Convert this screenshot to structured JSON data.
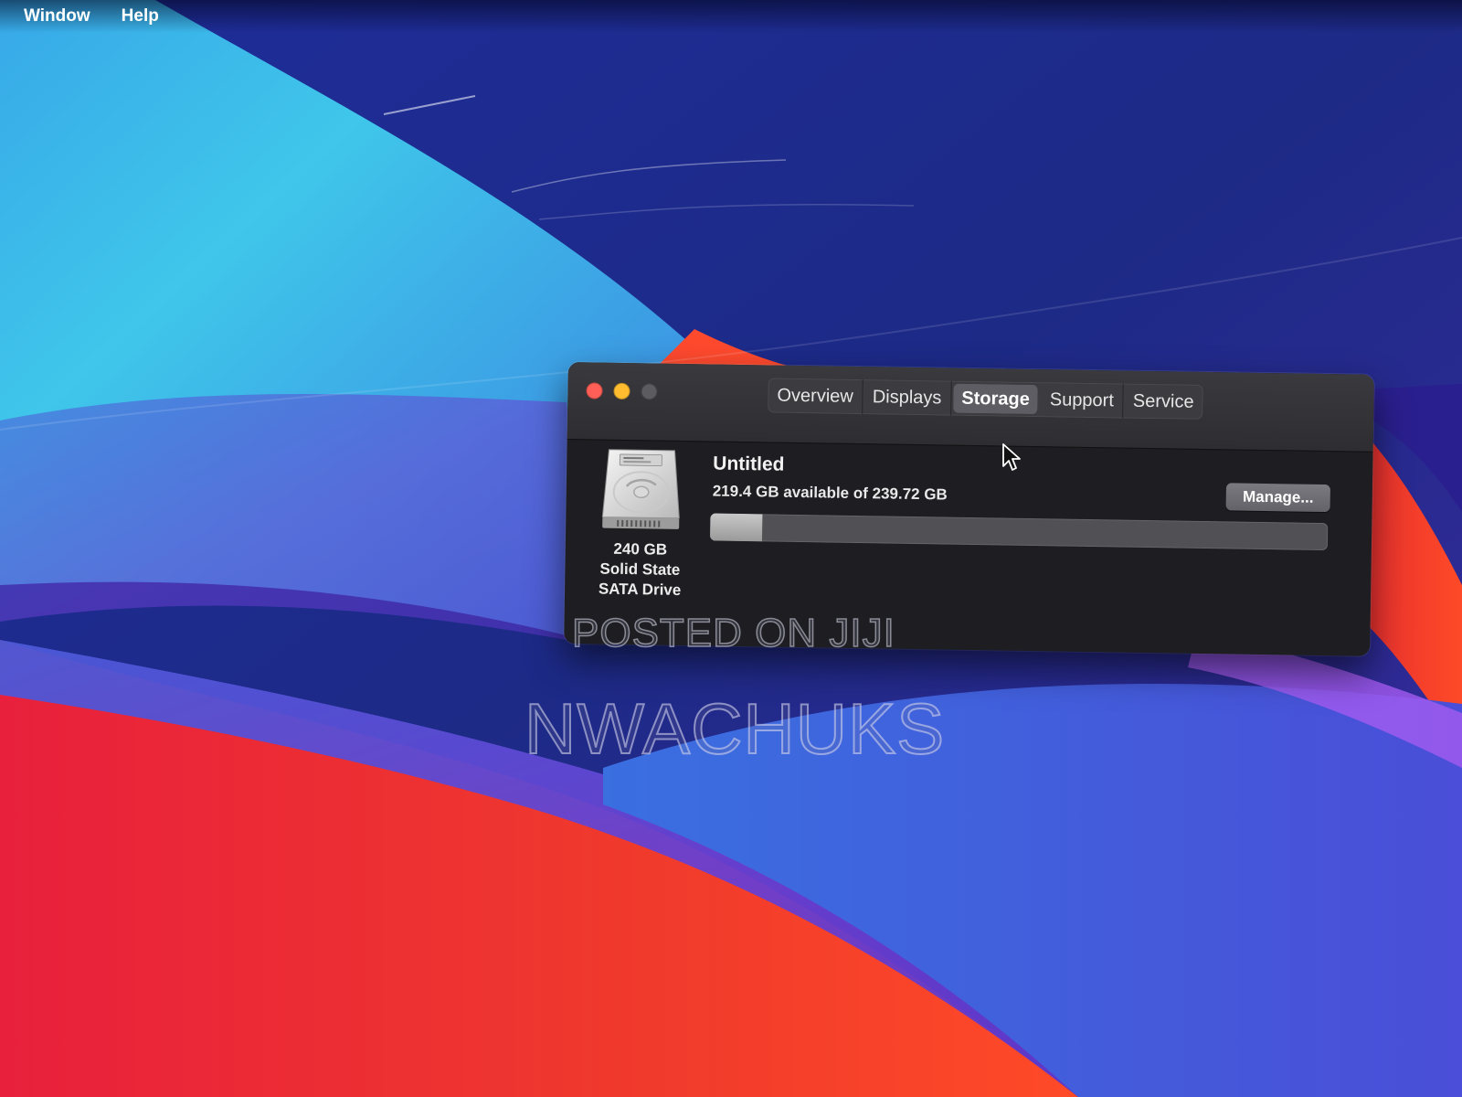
{
  "menubar": {
    "items": [
      "Window",
      "Help"
    ]
  },
  "window": {
    "tabs": [
      "Overview",
      "Displays",
      "Storage",
      "Support",
      "Service"
    ],
    "active_tab": "Storage"
  },
  "storage": {
    "disk_icon": "hard-drive-icon",
    "disk_capacity": "240 GB",
    "disk_type_line1": "Solid State",
    "disk_type_line2": "SATA Drive",
    "volume_name": "Untitled",
    "availability": "219.4 GB available of 239.72 GB",
    "used_fraction": 0.085,
    "manage_label": "Manage..."
  },
  "watermark": {
    "posted": "POSTED ON JIJI",
    "name": "NWACHUKS"
  },
  "colors": {
    "close": "#ff5f57",
    "minimize": "#febc2e",
    "zoom": "#5c5c60",
    "window_bg": "#1d1d22"
  }
}
